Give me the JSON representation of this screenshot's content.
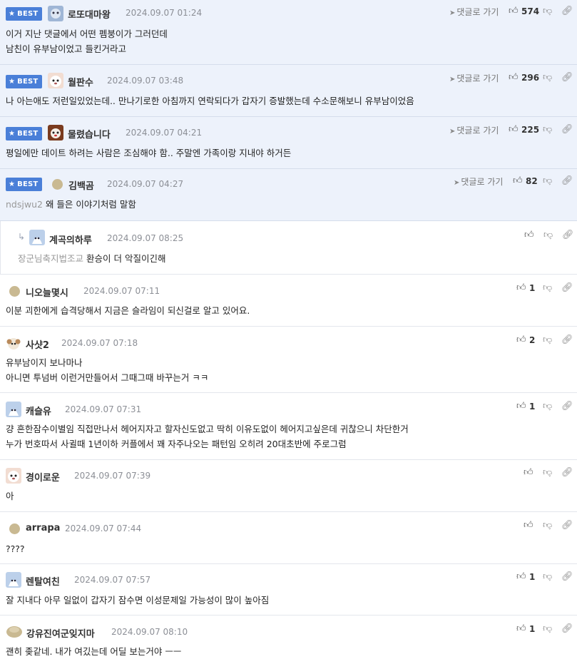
{
  "colors": {
    "best_bg": "#edf2fb",
    "badge": "#4a7fd8",
    "divider": "#e3e6ec"
  },
  "icons": {
    "thumb_up": "thumbs-up-icon",
    "thumb_down": "thumbs-down-icon",
    "link": "link-icon",
    "reply": "paper-plane-icon"
  },
  "ui": {
    "best_label": "BEST",
    "reply_link_label": "댓글로 가기"
  },
  "comments": [
    {
      "best": true,
      "nick": "로또대마왕",
      "date": "2024.09.07 01:24",
      "likes": "574",
      "lines": [
        "이거 지난 댓글에서 어떤 펨붕이가 그러던데",
        "남친이 유부남이었고 들킨거라고"
      ]
    },
    {
      "best": true,
      "nick": "월판수",
      "date": "2024.09.07 03:48",
      "likes": "296",
      "lines": [
        "나 아는애도 저런일있었는데.. 만나기로한 아침까지 연락되다가 갑자기 증발했는데 수소문해보니 유부남이었음"
      ]
    },
    {
      "best": true,
      "nick": "물렸습니다",
      "date": "2024.09.07 04:21",
      "likes": "225",
      "lines": [
        "평일에만 데이트 하려는 사람은 조심해야 함.. 주말엔 가족이랑 지내야 하거든"
      ]
    },
    {
      "best": true,
      "nick": "김백곰",
      "date": "2024.09.07 04:27",
      "likes": "82",
      "mention": "ndsjwu2",
      "lines": [
        "왜 들은 이야기처럼 말함"
      ]
    },
    {
      "best": false,
      "reply": true,
      "nick": "계곡의하루",
      "date": "2024.09.07 08:25",
      "likes": "",
      "mention": "장군님축지법조교",
      "lines": [
        "환승이 더 악질이긴해"
      ]
    },
    {
      "best": false,
      "nick": "니오늘몇시",
      "date": "2024.09.07 07:11",
      "likes": "1",
      "lines": [
        "이분 괴한에게 습격당해서 지금은 슬라임이 되신걸로 알고 있어요."
      ]
    },
    {
      "best": false,
      "nick": "사샷2",
      "date": "2024.09.07 07:18",
      "likes": "2",
      "lines": [
        "유부남이지 보나마나",
        "아니면 투넘버 이런거만들어서 그때그때 바꾸는거 ㅋㅋ"
      ]
    },
    {
      "best": false,
      "nick": "캐슬유",
      "date": "2024.09.07 07:31",
      "likes": "1",
      "lines": [
        "걍 흔한잠수이별임 직접만나서 헤어지자고 할자신도없고 딱히 이유도없이 헤어지고싶은데 귀찮으니 차단한거",
        "누가 번호따서 사귈때 1년이하 커플에서 꽤 자주나오는 패턴임 오히려 20대초반에 주로그럼"
      ]
    },
    {
      "best": false,
      "nick": "경이로운",
      "date": "2024.09.07 07:39",
      "likes": "",
      "lines": [
        "아"
      ]
    },
    {
      "best": false,
      "nick": "arrapa",
      "date": "2024.09.07 07:44",
      "likes": "",
      "lines": [
        "????"
      ]
    },
    {
      "best": false,
      "nick": "렌탈여친",
      "date": "2024.09.07 07:57",
      "likes": "1",
      "lines": [
        "잘 지내다 아무 일없이 갑자기 잠수면 이성문제일 가능성이 많이 높아짐"
      ]
    },
    {
      "best": false,
      "nick": "강유진여군잊지마",
      "date": "2024.09.07 08:10",
      "likes": "1",
      "lines": [
        "괜히 좆같네. 내가 여깄는데 어딜 보는거야 ㅡㅡ"
      ]
    }
  ]
}
